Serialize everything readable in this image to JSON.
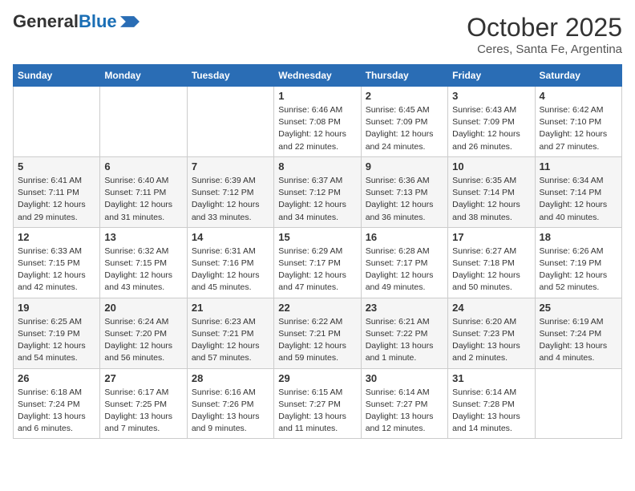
{
  "logo": {
    "text_general": "General",
    "text_blue": "Blue"
  },
  "title": "October 2025",
  "subtitle": "Ceres, Santa Fe, Argentina",
  "weekdays": [
    "Sunday",
    "Monday",
    "Tuesday",
    "Wednesday",
    "Thursday",
    "Friday",
    "Saturday"
  ],
  "weeks": [
    [
      {
        "day": "",
        "info": ""
      },
      {
        "day": "",
        "info": ""
      },
      {
        "day": "",
        "info": ""
      },
      {
        "day": "1",
        "info": "Sunrise: 6:46 AM\nSunset: 7:08 PM\nDaylight: 12 hours\nand 22 minutes."
      },
      {
        "day": "2",
        "info": "Sunrise: 6:45 AM\nSunset: 7:09 PM\nDaylight: 12 hours\nand 24 minutes."
      },
      {
        "day": "3",
        "info": "Sunrise: 6:43 AM\nSunset: 7:09 PM\nDaylight: 12 hours\nand 26 minutes."
      },
      {
        "day": "4",
        "info": "Sunrise: 6:42 AM\nSunset: 7:10 PM\nDaylight: 12 hours\nand 27 minutes."
      }
    ],
    [
      {
        "day": "5",
        "info": "Sunrise: 6:41 AM\nSunset: 7:11 PM\nDaylight: 12 hours\nand 29 minutes."
      },
      {
        "day": "6",
        "info": "Sunrise: 6:40 AM\nSunset: 7:11 PM\nDaylight: 12 hours\nand 31 minutes."
      },
      {
        "day": "7",
        "info": "Sunrise: 6:39 AM\nSunset: 7:12 PM\nDaylight: 12 hours\nand 33 minutes."
      },
      {
        "day": "8",
        "info": "Sunrise: 6:37 AM\nSunset: 7:12 PM\nDaylight: 12 hours\nand 34 minutes."
      },
      {
        "day": "9",
        "info": "Sunrise: 6:36 AM\nSunset: 7:13 PM\nDaylight: 12 hours\nand 36 minutes."
      },
      {
        "day": "10",
        "info": "Sunrise: 6:35 AM\nSunset: 7:14 PM\nDaylight: 12 hours\nand 38 minutes."
      },
      {
        "day": "11",
        "info": "Sunrise: 6:34 AM\nSunset: 7:14 PM\nDaylight: 12 hours\nand 40 minutes."
      }
    ],
    [
      {
        "day": "12",
        "info": "Sunrise: 6:33 AM\nSunset: 7:15 PM\nDaylight: 12 hours\nand 42 minutes."
      },
      {
        "day": "13",
        "info": "Sunrise: 6:32 AM\nSunset: 7:15 PM\nDaylight: 12 hours\nand 43 minutes."
      },
      {
        "day": "14",
        "info": "Sunrise: 6:31 AM\nSunset: 7:16 PM\nDaylight: 12 hours\nand 45 minutes."
      },
      {
        "day": "15",
        "info": "Sunrise: 6:29 AM\nSunset: 7:17 PM\nDaylight: 12 hours\nand 47 minutes."
      },
      {
        "day": "16",
        "info": "Sunrise: 6:28 AM\nSunset: 7:17 PM\nDaylight: 12 hours\nand 49 minutes."
      },
      {
        "day": "17",
        "info": "Sunrise: 6:27 AM\nSunset: 7:18 PM\nDaylight: 12 hours\nand 50 minutes."
      },
      {
        "day": "18",
        "info": "Sunrise: 6:26 AM\nSunset: 7:19 PM\nDaylight: 12 hours\nand 52 minutes."
      }
    ],
    [
      {
        "day": "19",
        "info": "Sunrise: 6:25 AM\nSunset: 7:19 PM\nDaylight: 12 hours\nand 54 minutes."
      },
      {
        "day": "20",
        "info": "Sunrise: 6:24 AM\nSunset: 7:20 PM\nDaylight: 12 hours\nand 56 minutes."
      },
      {
        "day": "21",
        "info": "Sunrise: 6:23 AM\nSunset: 7:21 PM\nDaylight: 12 hours\nand 57 minutes."
      },
      {
        "day": "22",
        "info": "Sunrise: 6:22 AM\nSunset: 7:21 PM\nDaylight: 12 hours\nand 59 minutes."
      },
      {
        "day": "23",
        "info": "Sunrise: 6:21 AM\nSunset: 7:22 PM\nDaylight: 13 hours\nand 1 minute."
      },
      {
        "day": "24",
        "info": "Sunrise: 6:20 AM\nSunset: 7:23 PM\nDaylight: 13 hours\nand 2 minutes."
      },
      {
        "day": "25",
        "info": "Sunrise: 6:19 AM\nSunset: 7:24 PM\nDaylight: 13 hours\nand 4 minutes."
      }
    ],
    [
      {
        "day": "26",
        "info": "Sunrise: 6:18 AM\nSunset: 7:24 PM\nDaylight: 13 hours\nand 6 minutes."
      },
      {
        "day": "27",
        "info": "Sunrise: 6:17 AM\nSunset: 7:25 PM\nDaylight: 13 hours\nand 7 minutes."
      },
      {
        "day": "28",
        "info": "Sunrise: 6:16 AM\nSunset: 7:26 PM\nDaylight: 13 hours\nand 9 minutes."
      },
      {
        "day": "29",
        "info": "Sunrise: 6:15 AM\nSunset: 7:27 PM\nDaylight: 13 hours\nand 11 minutes."
      },
      {
        "day": "30",
        "info": "Sunrise: 6:14 AM\nSunset: 7:27 PM\nDaylight: 13 hours\nand 12 minutes."
      },
      {
        "day": "31",
        "info": "Sunrise: 6:14 AM\nSunset: 7:28 PM\nDaylight: 13 hours\nand 14 minutes."
      },
      {
        "day": "",
        "info": ""
      }
    ]
  ]
}
